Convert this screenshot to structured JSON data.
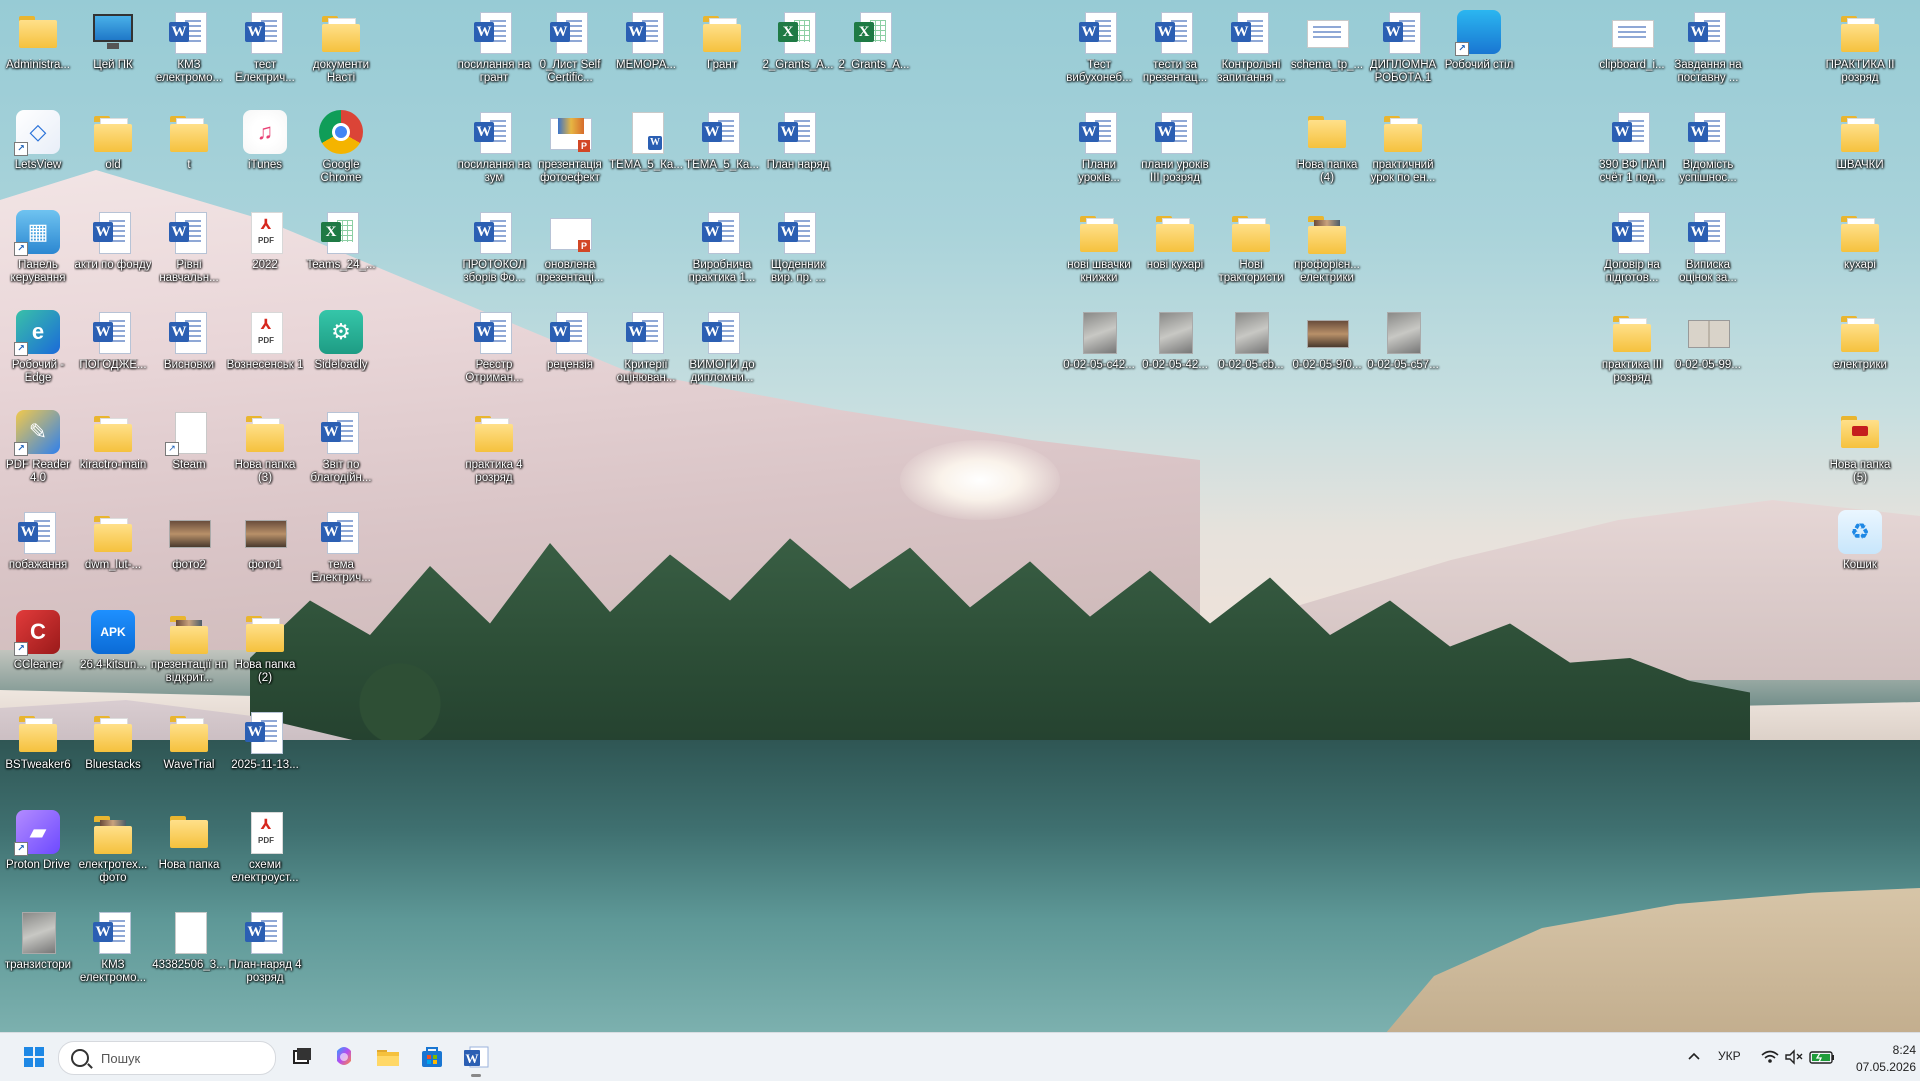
{
  "desktop": {
    "icons": [
      {
        "label": "Administra...",
        "type": "folder",
        "col": 0,
        "row": 0
      },
      {
        "label": "Цей ПК",
        "type": "monitor",
        "col": 1,
        "row": 0
      },
      {
        "label": "КМЗ електромо...",
        "type": "doc",
        "col": 2,
        "row": 0
      },
      {
        "label": "тест Електрич...",
        "type": "doc",
        "col": 3,
        "row": 0
      },
      {
        "label": "документи Насті",
        "type": "folder-doc",
        "col": 4,
        "row": 0
      },
      {
        "label": "LetsView",
        "type": "letsview",
        "col": 0,
        "row": 1,
        "shortcut": true
      },
      {
        "label": "old",
        "type": "folder-doc",
        "col": 1,
        "row": 1
      },
      {
        "label": "t",
        "type": "folder-doc",
        "col": 2,
        "row": 1
      },
      {
        "label": "iTunes",
        "type": "itunes",
        "col": 3,
        "row": 1
      },
      {
        "label": "Google Chrome",
        "type": "chrome",
        "col": 4,
        "row": 1
      },
      {
        "label": "Панель керування",
        "type": "controlpanel",
        "col": 0,
        "row": 2,
        "shortcut": true
      },
      {
        "label": "акти по фонду",
        "type": "doc",
        "col": 1,
        "row": 2
      },
      {
        "label": "Рівні навчальн...",
        "type": "doc",
        "col": 2,
        "row": 2
      },
      {
        "label": "2022",
        "type": "pdf",
        "col": 3,
        "row": 2
      },
      {
        "label": "Teams_24_...",
        "type": "xls",
        "col": 4,
        "row": 2
      },
      {
        "label": "Робочий - Edge",
        "type": "edge",
        "col": 0,
        "row": 3,
        "shortcut": true
      },
      {
        "label": "ПОГОДЖЕ...",
        "type": "doc",
        "col": 1,
        "row": 3
      },
      {
        "label": "Висновки",
        "type": "doc",
        "col": 2,
        "row": 3
      },
      {
        "label": "Вознесенськ 1",
        "type": "pdf",
        "col": 3,
        "row": 3
      },
      {
        "label": "Sideloadly",
        "type": "sideloadly",
        "col": 4,
        "row": 3
      },
      {
        "label": "PDF Reader 4.0",
        "type": "pdfreader",
        "col": 0,
        "row": 4,
        "shortcut": true
      },
      {
        "label": "kiractro-main",
        "type": "folder-doc",
        "col": 1,
        "row": 4
      },
      {
        "label": "Steam",
        "type": "blank",
        "col": 2,
        "row": 4,
        "shortcut": true
      },
      {
        "label": "Нова папка (3)",
        "type": "folder-doc",
        "col": 3,
        "row": 4
      },
      {
        "label": "Звіт по благодійн...",
        "type": "doc",
        "col": 4,
        "row": 4
      },
      {
        "label": "побажання",
        "type": "doc",
        "col": 0,
        "row": 5
      },
      {
        "label": "dwm_lut-...",
        "type": "folder-doc",
        "col": 1,
        "row": 5
      },
      {
        "label": "фото2",
        "type": "photo-wide",
        "col": 2,
        "row": 5
      },
      {
        "label": "фото1",
        "type": "photo-wide",
        "col": 3,
        "row": 5
      },
      {
        "label": "тема Електрич...",
        "type": "doc",
        "col": 4,
        "row": 5
      },
      {
        "label": "CCleaner",
        "type": "ccleaner",
        "col": 0,
        "row": 6,
        "shortcut": true
      },
      {
        "label": "26.4-kitsun...",
        "type": "apk",
        "col": 1,
        "row": 6
      },
      {
        "label": "презентації нп відкрит...",
        "type": "folder-photo",
        "col": 2,
        "row": 6
      },
      {
        "label": "Нова папка (2)",
        "type": "folder-doc",
        "col": 3,
        "row": 6
      },
      {
        "label": "BSTweaker6",
        "type": "folder-doc",
        "col": 0,
        "row": 7
      },
      {
        "label": "Bluestacks",
        "type": "folder-doc",
        "col": 1,
        "row": 7
      },
      {
        "label": "WaveTrial",
        "type": "folder-doc",
        "col": 2,
        "row": 7
      },
      {
        "label": "2025-11-13...",
        "type": "doc",
        "col": 3,
        "row": 7
      },
      {
        "label": "Proton Drive",
        "type": "proton",
        "col": 0,
        "row": 8,
        "shortcut": true
      },
      {
        "label": "електротех... фото",
        "type": "folder-photo",
        "col": 1,
        "row": 8
      },
      {
        "label": "Нова папка",
        "type": "folder",
        "col": 2,
        "row": 8
      },
      {
        "label": "схеми електроуст...",
        "type": "pdf",
        "col": 3,
        "row": 8
      },
      {
        "label": "транзистори",
        "type": "photo",
        "col": 0,
        "row": 9
      },
      {
        "label": "КМЗ електромо...",
        "type": "doc",
        "col": 1,
        "row": 9
      },
      {
        "label": "43382506_3...",
        "type": "blank",
        "col": 2,
        "row": 9
      },
      {
        "label": "План-наряд 4 розряд",
        "type": "doc",
        "col": 3,
        "row": 9
      },
      {
        "label": "посилання на грант",
        "type": "doc",
        "col": 6,
        "row": 0
      },
      {
        "label": "0_Лист Self Certific...",
        "type": "doc",
        "col": 7,
        "row": 0
      },
      {
        "label": "МЕМОРА...",
        "type": "doc",
        "col": 8,
        "row": 0
      },
      {
        "label": "Грант",
        "type": "folder-doc",
        "col": 9,
        "row": 0
      },
      {
        "label": "2_Grants_A...",
        "type": "xls",
        "col": 10,
        "row": 0
      },
      {
        "label": "2_Grants_A...",
        "type": "xls",
        "col": 11,
        "row": 0
      },
      {
        "label": "посилання на зум",
        "type": "doc",
        "col": 6,
        "row": 1
      },
      {
        "label": "презентація фотоефект",
        "type": "ppt",
        "col": 7,
        "row": 1
      },
      {
        "label": "ТЕМА_5_Ка...",
        "type": "blank-w",
        "col": 8,
        "row": 1
      },
      {
        "label": "ТЕМА_5_Ка...",
        "type": "doc",
        "col": 9,
        "row": 1
      },
      {
        "label": "План наряд",
        "type": "doc",
        "col": 10,
        "row": 1
      },
      {
        "label": "ПРОТОКОЛ зборів Фо...",
        "type": "doc",
        "col": 6,
        "row": 2
      },
      {
        "label": "оновлена презентаці...",
        "type": "ppt-blank",
        "col": 7,
        "row": 2
      },
      {
        "label": "Виробнича практика 1...",
        "type": "doc",
        "col": 9,
        "row": 2
      },
      {
        "label": "Щоденник вир. пр. ...",
        "type": "doc",
        "col": 10,
        "row": 2
      },
      {
        "label": "Реєстр Отриман...",
        "type": "doc",
        "col": 6,
        "row": 3
      },
      {
        "label": "рецензія",
        "type": "doc",
        "col": 7,
        "row": 3
      },
      {
        "label": "Критерії оцінюван...",
        "type": "doc",
        "col": 8,
        "row": 3
      },
      {
        "label": "ВИМОГИ до дипломни...",
        "type": "doc",
        "col": 9,
        "row": 3
      },
      {
        "label": "практика 4 розряд",
        "type": "folder-doc",
        "col": 6,
        "row": 4
      },
      {
        "label": "Тест вибухонеб...",
        "type": "doc",
        "col": 14,
        "row": 0
      },
      {
        "label": "тести за презентац...",
        "type": "doc",
        "col": 15,
        "row": 0
      },
      {
        "label": "Контрольні запитання ...",
        "type": "doc",
        "col": 16,
        "row": 0
      },
      {
        "label": "schema_tp_...",
        "type": "image-doc",
        "col": 17,
        "row": 0
      },
      {
        "label": "ДИПЛОМНА РОБОТА.1",
        "type": "doc",
        "col": 18,
        "row": 0
      },
      {
        "label": "Робочий стіл",
        "type": "desktopfolder",
        "col": 19,
        "row": 0,
        "shortcut": true
      },
      {
        "label": "Плани уроків...",
        "type": "doc",
        "col": 14,
        "row": 1
      },
      {
        "label": "плани уроків III розряд",
        "type": "doc",
        "col": 15,
        "row": 1
      },
      {
        "label": "Нова папка (4)",
        "type": "folder",
        "col": 17,
        "row": 1
      },
      {
        "label": "практичний урок по ен...",
        "type": "folder-doc",
        "col": 18,
        "row": 1
      },
      {
        "label": "нові швачки книжки",
        "type": "folder-doc",
        "col": 14,
        "row": 2
      },
      {
        "label": "нові кухарі",
        "type": "folder-doc",
        "col": 15,
        "row": 2
      },
      {
        "label": "Нові трактористи",
        "type": "folder-doc",
        "col": 16,
        "row": 2
      },
      {
        "label": "профорієн... електрики",
        "type": "folder-photo",
        "col": 17,
        "row": 2
      },
      {
        "label": "0-02-05-c42...",
        "type": "photo",
        "col": 14,
        "row": 3
      },
      {
        "label": "0-02-05-42...",
        "type": "photo",
        "col": 15,
        "row": 3
      },
      {
        "label": "0-02-05-cb...",
        "type": "photo",
        "col": 16,
        "row": 3
      },
      {
        "label": "0-02-05-9f0...",
        "type": "photo-wide",
        "col": 17,
        "row": 3
      },
      {
        "label": "0-02-05-c57...",
        "type": "photo",
        "col": 18,
        "row": 3
      },
      {
        "label": "clipboard_i...",
        "type": "image-doc",
        "col": 21,
        "row": 0
      },
      {
        "label": "Завдання на поставну ...",
        "type": "doc",
        "col": 22,
        "row": 0
      },
      {
        "label": "390 ВФ ПАП счёт 1 под...",
        "type": "doc",
        "col": 21,
        "row": 1
      },
      {
        "label": "Відомість успішнос...",
        "type": "doc",
        "col": 22,
        "row": 1
      },
      {
        "label": "Договір на підготов...",
        "type": "doc",
        "col": 21,
        "row": 2
      },
      {
        "label": "Виписка оцінок за...",
        "type": "doc",
        "col": 22,
        "row": 2
      },
      {
        "label": "практика III розряд",
        "type": "folder-doc",
        "col": 21,
        "row": 3
      },
      {
        "label": "0-02-05-99...",
        "type": "book",
        "col": 22,
        "row": 3
      },
      {
        "label": "ПРАКТИКА II розряд",
        "type": "folder-doc",
        "col": 24,
        "row": 0
      },
      {
        "label": "ШВАЧКИ",
        "type": "folder-doc",
        "col": 24,
        "row": 1
      },
      {
        "label": "кухарі",
        "type": "folder-doc",
        "col": 24,
        "row": 2
      },
      {
        "label": "електрики",
        "type": "folder-doc",
        "col": 24,
        "row": 3
      },
      {
        "label": "Нова папка (5)",
        "type": "folder-red",
        "col": 24,
        "row": 4
      },
      {
        "label": "Кошик",
        "type": "recycle",
        "col": 24,
        "row": 5
      }
    ]
  },
  "taskbar": {
    "search_placeholder": "Пошук",
    "pinned": [
      "task-view",
      "copilot",
      "file-explorer",
      "microsoft-store",
      "word"
    ],
    "language": "УКР",
    "time": "8:24",
    "date": "07.05.2026",
    "colors": {
      "accent": "#1e88e5",
      "word": "#2b5fb3",
      "excel": "#1f7a45",
      "folder": "#f5c13d"
    }
  }
}
